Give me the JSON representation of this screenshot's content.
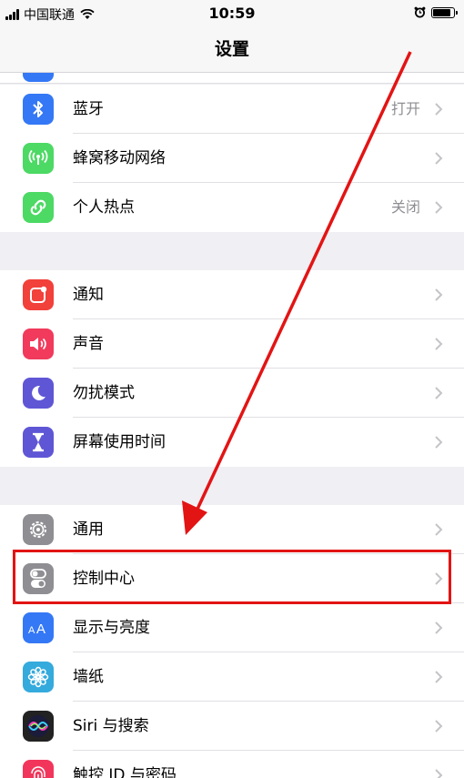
{
  "status_bar": {
    "carrier": "中国联通",
    "time": "10:59"
  },
  "nav": {
    "title": "设置"
  },
  "group1": [
    {
      "label": "蓝牙",
      "value": "打开",
      "icon": "bluetooth-icon",
      "color": "#3478f6"
    },
    {
      "label": "蜂窝移动网络",
      "value": "",
      "icon": "cellular-icon",
      "color": "#4cd964"
    },
    {
      "label": "个人热点",
      "value": "关闭",
      "icon": "hotspot-icon",
      "color": "#4cd964"
    }
  ],
  "group2": [
    {
      "label": "通知",
      "icon": "notifications-icon",
      "color": "#f2403a"
    },
    {
      "label": "声音",
      "icon": "sounds-icon",
      "color": "#f13a5c"
    },
    {
      "label": "勿扰模式",
      "icon": "moon-icon",
      "color": "#5f56d6"
    },
    {
      "label": "屏幕使用时间",
      "icon": "hourglass-icon",
      "color": "#5f56d6"
    }
  ],
  "group3": [
    {
      "label": "通用",
      "icon": "gear-icon",
      "color": "#8e8e93"
    },
    {
      "label": "控制中心",
      "icon": "toggles-icon",
      "color": "#8e8e93"
    },
    {
      "label": "显示与亮度",
      "icon": "display-icon",
      "color": "#3478f6"
    },
    {
      "label": "墙纸",
      "icon": "flower-icon",
      "color": "#35aadc"
    },
    {
      "label": "Siri 与搜索",
      "icon": "siri-icon",
      "color": "#222222"
    },
    {
      "label": "触控 ID 与密码",
      "icon": "fingerprint-icon",
      "color": "#f2365b"
    }
  ],
  "annotation": {
    "highlight_color": "#e31414"
  }
}
